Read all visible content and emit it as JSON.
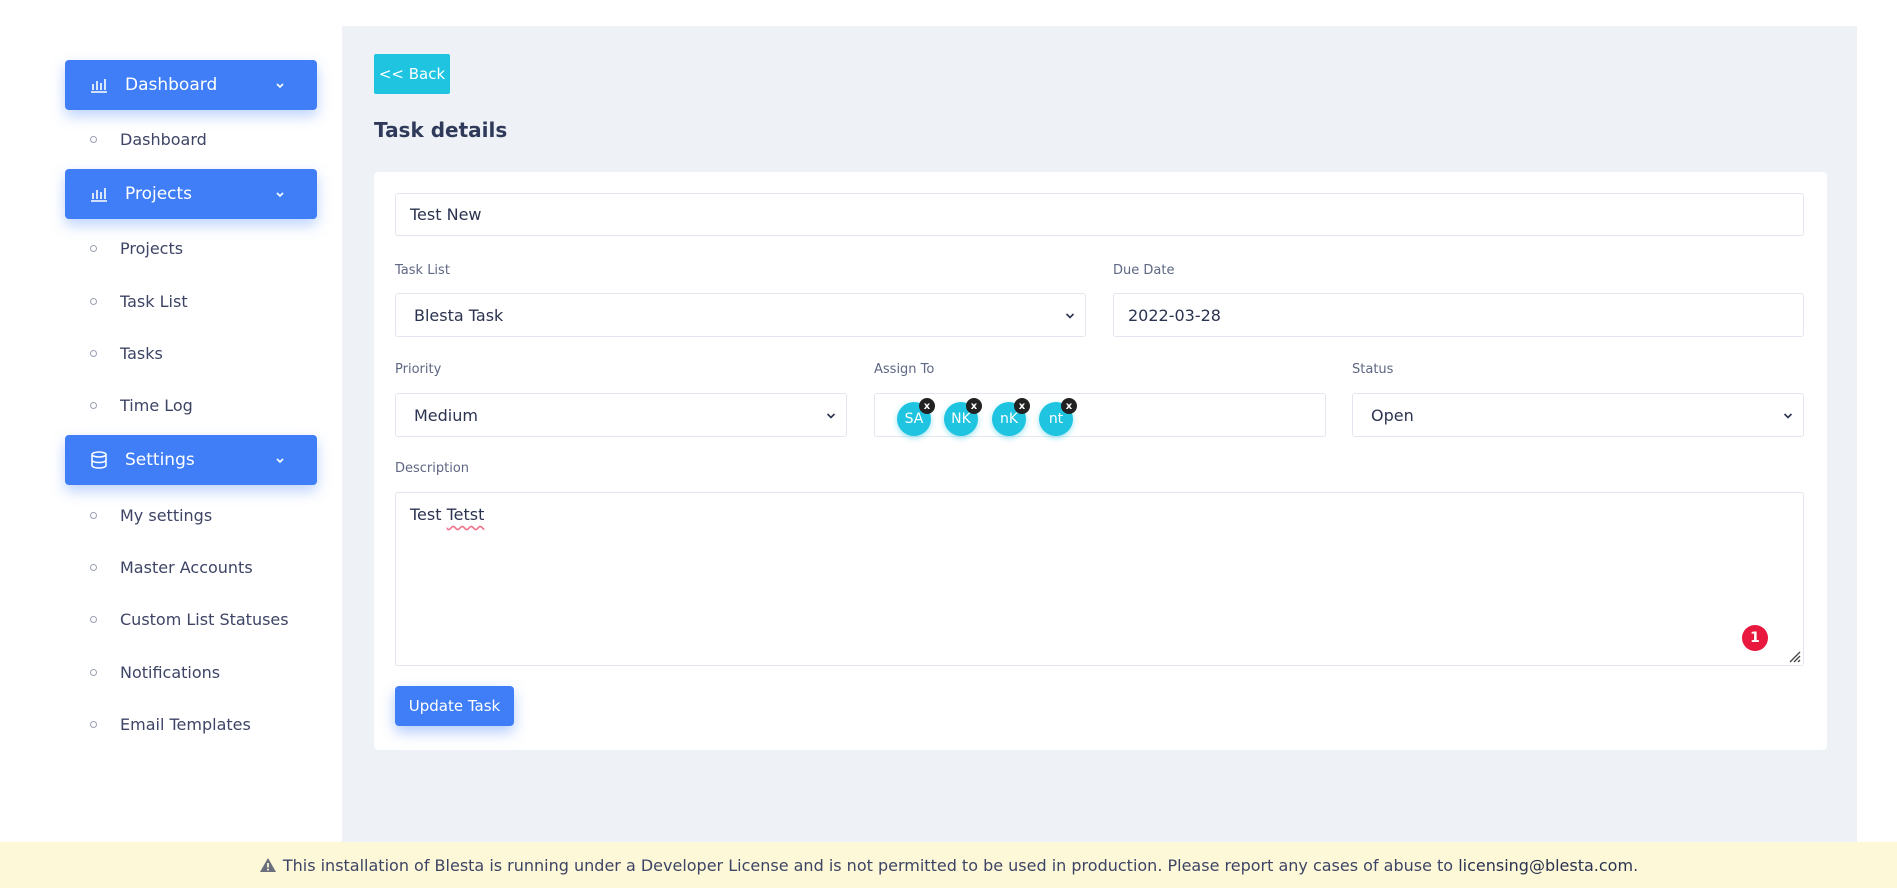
{
  "sidebar": {
    "groups": [
      {
        "label": "Dashboard",
        "items": [
          "Dashboard"
        ]
      },
      {
        "label": "Projects",
        "items": [
          "Projects",
          "Task List",
          "Tasks",
          "Time Log"
        ]
      },
      {
        "label": "Settings",
        "items": [
          "My settings",
          "Master Accounts",
          "Custom List Statuses",
          "Notifications",
          "Email Templates"
        ]
      }
    ]
  },
  "header": {
    "back_label": "<< Back",
    "title": "Task details"
  },
  "form": {
    "task_name": "Test New",
    "task_list": {
      "label": "Task List",
      "value": "Blesta Task"
    },
    "due_date": {
      "label": "Due Date",
      "value": "2022-03-28"
    },
    "priority": {
      "label": "Priority",
      "value": "Medium"
    },
    "assign_to": {
      "label": "Assign To",
      "assignees": [
        "SA",
        "NK",
        "nK",
        "nt"
      ],
      "remove_glyph": "x"
    },
    "status": {
      "label": "Status",
      "value": "Open"
    },
    "description": {
      "label": "Description",
      "text_plain": "Test ",
      "text_misspelled": "Tetst",
      "alert_count": "1"
    },
    "submit_label": "Update Task"
  },
  "banner": {
    "text": "This installation of Blesta is running under a Developer License and is not permitted to be used in production. Please report any cases of abuse to",
    "link": "licensing@blesta.com",
    "suffix": "."
  },
  "colors": {
    "primary": "#3f7ef6",
    "accent": "#1ec4e0",
    "alert": "#e8183f",
    "banner_bg": "#fdf8d8"
  },
  "icons": {
    "dashboard_group": "bar-chart-icon",
    "projects_group": "bar-chart-icon",
    "settings_group": "database-icon",
    "chevron": "chevron-down-icon",
    "warning": "warning-triangle-icon"
  }
}
